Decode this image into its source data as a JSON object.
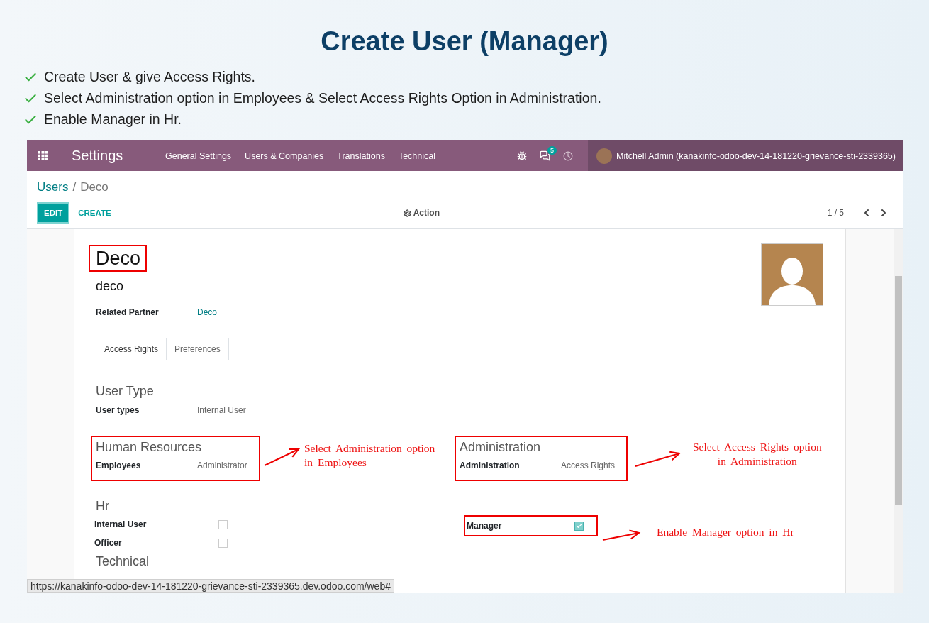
{
  "slide": {
    "title": "Create User (Manager)",
    "bullets": [
      "Create User & give Access Rights.",
      "Select Administration option in Employees & Select Access  Rights Option in Administration.",
      "Enable Manager in Hr."
    ]
  },
  "navbar": {
    "app": "Settings",
    "menu": [
      "General Settings",
      "Users & Companies",
      "Translations",
      "Technical"
    ],
    "chat_count": "5",
    "user": "Mitchell Admin (kanakinfo-odoo-dev-14-181220-grievance-sti-2339365)"
  },
  "breadcrumb": {
    "parent": "Users",
    "separator": "/",
    "current": "Deco"
  },
  "toolbar": {
    "edit": "EDIT",
    "create": "CREATE",
    "action": "Action",
    "pager": "1 / 5"
  },
  "form": {
    "name": "Deco",
    "login": "deco",
    "related_partner": {
      "label": "Related Partner",
      "value": "Deco"
    },
    "tabs": [
      {
        "label": "Access Rights",
        "selected": true
      },
      {
        "label": "Preferences",
        "selected": false
      }
    ],
    "user_type": {
      "title": "User Type",
      "label": "User types",
      "value": "Internal User"
    },
    "groups": [
      {
        "title": "Human Resources",
        "label": "Employees",
        "value": "Administrator",
        "highlighted": true
      },
      {
        "title": "Administration",
        "label": "Administration",
        "value": "Access Rights",
        "highlighted": true
      }
    ],
    "hr": {
      "title": "Hr",
      "left": [
        {
          "label": "Internal User",
          "checked": false,
          "highlighted": false
        },
        {
          "label": "Officer",
          "checked": false,
          "highlighted": false
        }
      ],
      "right": [
        {
          "label": "Manager",
          "checked": true,
          "highlighted": true
        }
      ]
    },
    "next_section": "Technical"
  },
  "annotations": [
    {
      "lines": [
        "Select Administration option",
        "in Employees"
      ]
    },
    {
      "lines": [
        "Select Access Rights option",
        "in Administration"
      ]
    },
    {
      "lines": [
        "Enable Manager option in Hr"
      ]
    }
  ],
  "status_url": "https://kanakinfo-odoo-dev-14-181220-grievance-sti-2339365.dev.odoo.com/web#"
}
